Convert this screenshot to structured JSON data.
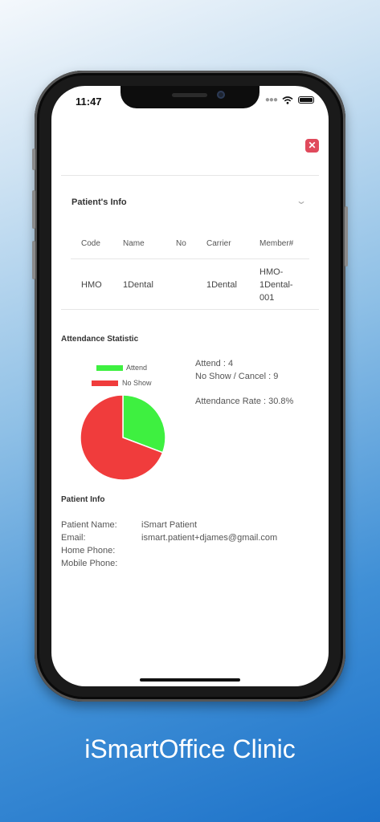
{
  "status_bar": {
    "time": "11:47"
  },
  "patients_info": {
    "title": "Patient's Info",
    "columns": [
      "Code",
      "Name",
      "No",
      "Carrier",
      "Member#"
    ],
    "rows": [
      {
        "code": "HMO",
        "name": "1Dental",
        "no": "",
        "carrier": "1Dental",
        "member_lines": [
          "HMO-",
          "1Dental-",
          "001"
        ]
      }
    ]
  },
  "attendance": {
    "title": "Attendance Statistic",
    "attend_text": "Attend : 4",
    "noshow_text": "No Show / Cancel : 9",
    "rate_text": "Attendance Rate : 30.8%",
    "legend": {
      "attend": "Attend",
      "noshow": "No Show"
    },
    "colors": {
      "attend": "#3ef040",
      "noshow": "#f03c3c"
    },
    "chart_data": {
      "type": "pie",
      "categories": [
        "Attend",
        "No Show"
      ],
      "values": [
        4,
        9
      ]
    }
  },
  "patient_info": {
    "title": "Patient Info",
    "name_label": "Patient Name:",
    "name_value": "iSmart Patient",
    "email_label": "Email:",
    "email_value": "ismart.patient+djames@gmail.com",
    "home_phone_label": "Home Phone:",
    "mobile_phone_label": "Mobile Phone:"
  },
  "caption": "iSmartOffice Clinic"
}
